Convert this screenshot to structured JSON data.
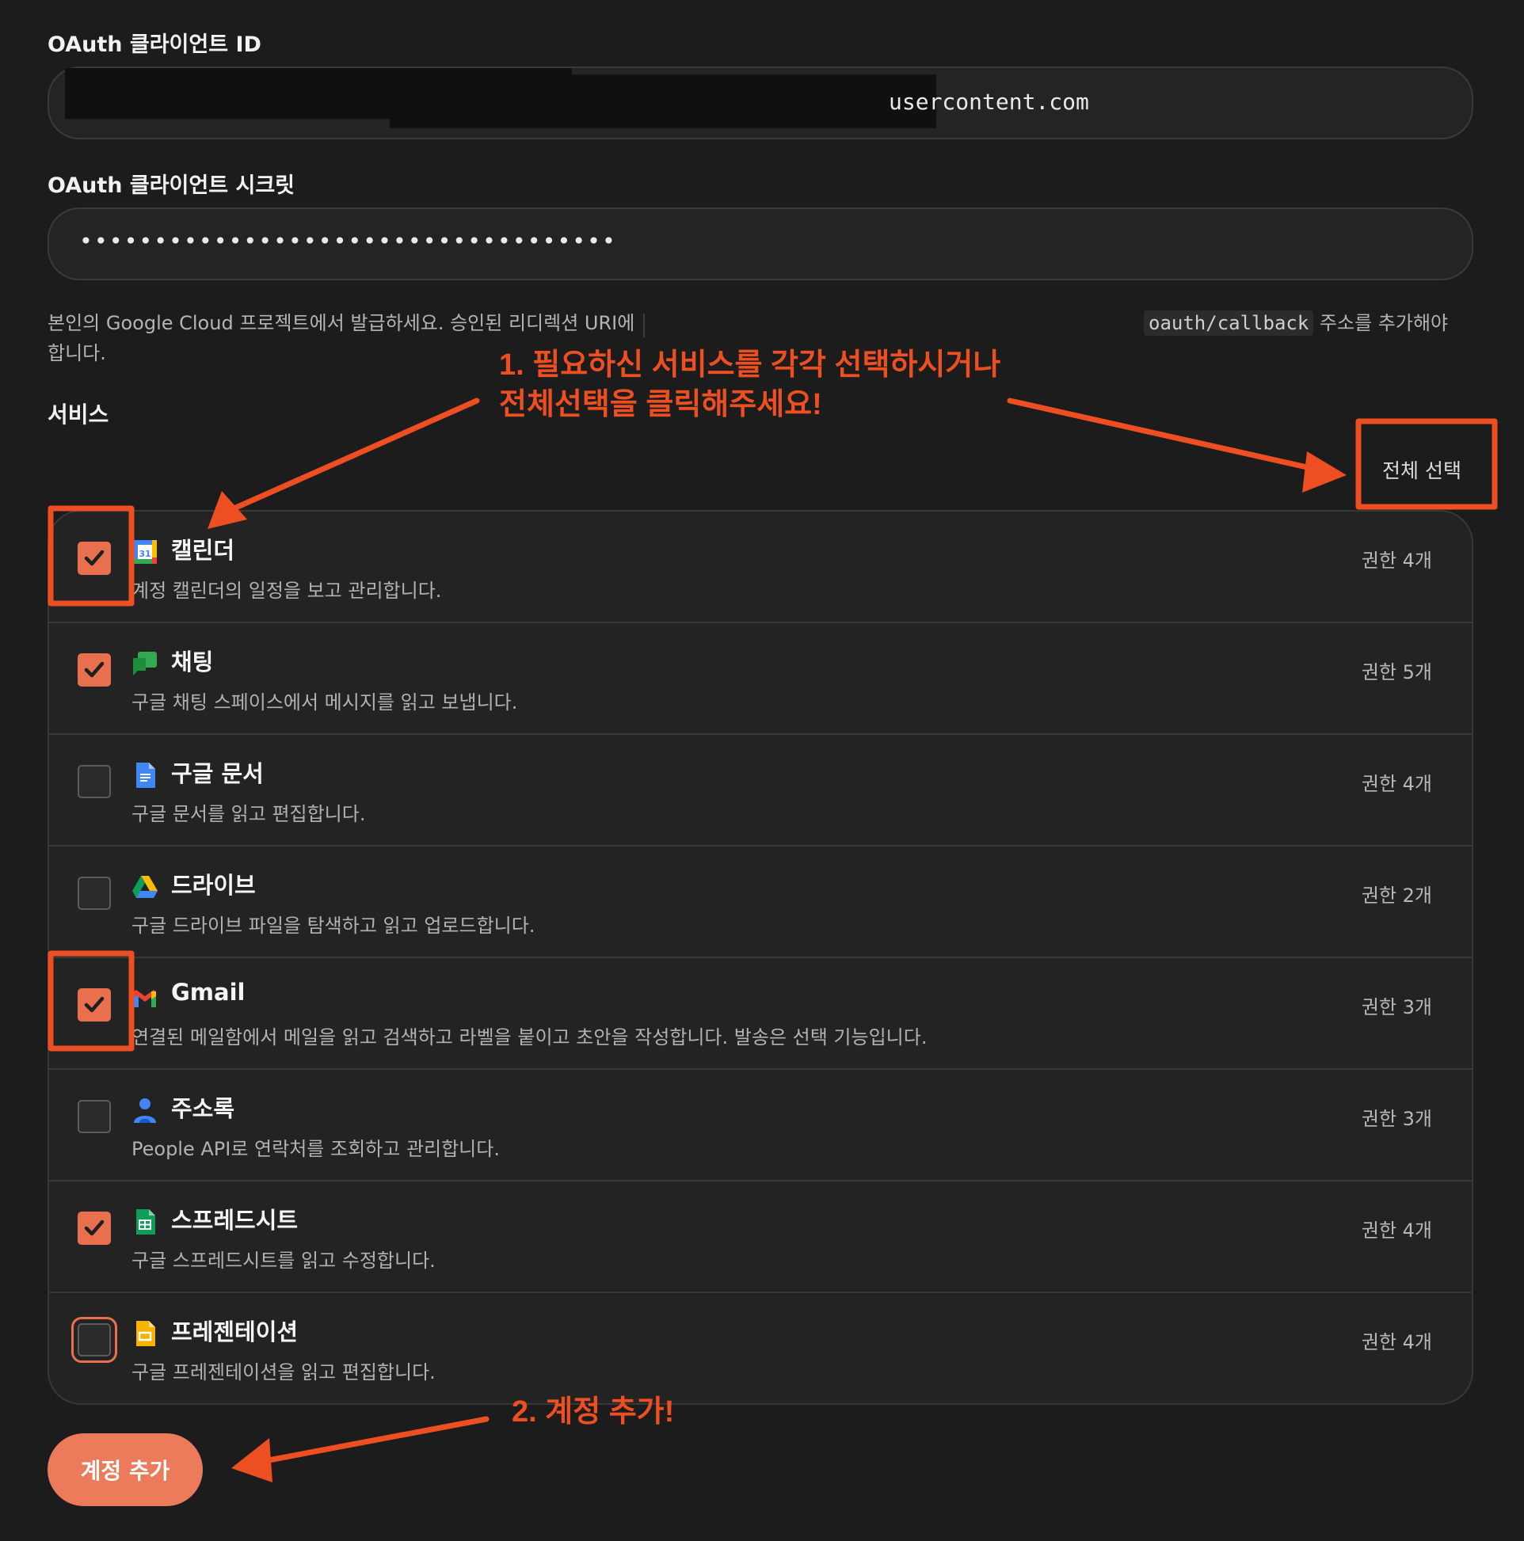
{
  "client_id": {
    "label": "OAuth 클라이언트 ID",
    "value_visible": "usercontent.com"
  },
  "client_secret": {
    "label": "OAuth 클라이언트 시크릿",
    "masked_value": "••••••••••••••••••••••••••••••••••••"
  },
  "help": {
    "line1_prefix": "본인의 Google Cloud 프로젝트에서 발급하세요. 승인된 리디렉션 URI에",
    "callback_code": "oauth/callback",
    "line1_suffix": " 주소를 추가해야",
    "line2": "합니다."
  },
  "services_section": {
    "title": "서비스",
    "select_all_label": "전체 선택",
    "items": [
      {
        "icon": "calendar-icon",
        "name": "캘린더",
        "desc": "계정 캘린더의 일정을 보고 관리합니다.",
        "permissions": "권한 4개",
        "checked": true
      },
      {
        "icon": "chat-icon",
        "name": "채팅",
        "desc": "구글 채팅 스페이스에서 메시지를 읽고 보냅니다.",
        "permissions": "권한 5개",
        "checked": true
      },
      {
        "icon": "docs-icon",
        "name": "구글 문서",
        "desc": "구글 문서를 읽고 편집합니다.",
        "permissions": "권한 4개",
        "checked": false
      },
      {
        "icon": "drive-icon",
        "name": "드라이브",
        "desc": "구글 드라이브 파일을 탐색하고 읽고 업로드합니다.",
        "permissions": "권한 2개",
        "checked": false
      },
      {
        "icon": "gmail-icon",
        "name": "Gmail",
        "desc": "연결된 메일함에서 메일을 읽고 검색하고 라벨을 붙이고 초안을 작성합니다. 발송은 선택 기능입니다.",
        "permissions": "권한 3개",
        "checked": true
      },
      {
        "icon": "contacts-icon",
        "name": "주소록",
        "desc": "People API로 연락처를 조회하고 관리합니다.",
        "permissions": "권한 3개",
        "checked": false
      },
      {
        "icon": "sheets-icon",
        "name": "스프레드시트",
        "desc": "구글 스프레드시트를 읽고 수정합니다.",
        "permissions": "권한 4개",
        "checked": true
      },
      {
        "icon": "slides-icon",
        "name": "프레젠테이션",
        "desc": "구글 프레젠테이션을 읽고 편집합니다.",
        "permissions": "권한 4개",
        "checked": false
      }
    ]
  },
  "add_button_label": "계정 추가",
  "annotations": {
    "step1_line1": "1. 필요하신 서비스를 각각 선택하시거나",
    "step1_line2": "전체선택을 클릭해주세요!",
    "step2": "2. 계정 추가!",
    "color": "#ee4f22"
  },
  "colors": {
    "background": "#1c1c1c",
    "accent": "#e8704f",
    "button": "#ec7b5b"
  }
}
